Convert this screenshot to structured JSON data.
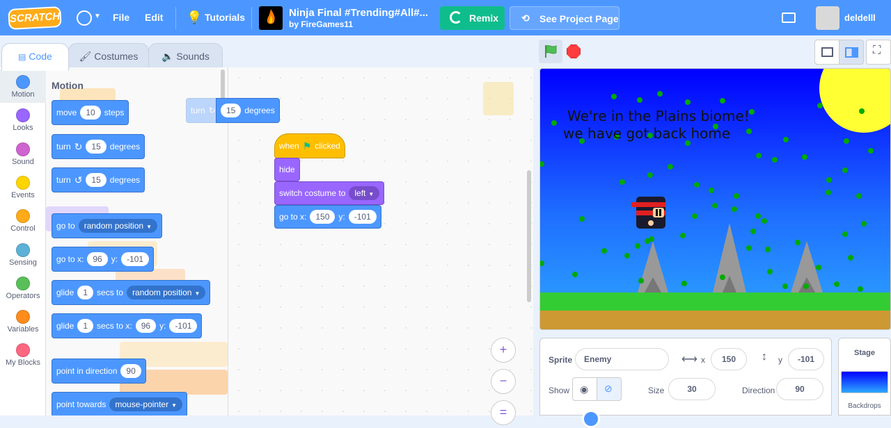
{
  "menubar": {
    "logo": "SCRATCH",
    "file": "File",
    "edit": "Edit",
    "tutorials": "Tutorials",
    "project_title": "Ninja Final #Trending#All#...",
    "project_author": "by FireGames11",
    "remix": "Remix",
    "see_project": "See Project Page",
    "username": "deldelll"
  },
  "tabs": {
    "code": "Code",
    "costumes": "Costumes",
    "sounds": "Sounds"
  },
  "categories": [
    {
      "label": "Motion",
      "color": "#4c97ff"
    },
    {
      "label": "Looks",
      "color": "#9966ff"
    },
    {
      "label": "Sound",
      "color": "#cf63cf"
    },
    {
      "label": "Events",
      "color": "#ffd500"
    },
    {
      "label": "Control",
      "color": "#ffab19"
    },
    {
      "label": "Sensing",
      "color": "#5cb1d6"
    },
    {
      "label": "Operators",
      "color": "#59c059"
    },
    {
      "label": "Variables",
      "color": "#ff8c1a"
    },
    {
      "label": "My Blocks",
      "color": "#ff6680"
    }
  ],
  "flyout": {
    "title": "Motion",
    "move": {
      "label": "move",
      "value": "10",
      "suffix": "steps"
    },
    "turn_right": {
      "label": "turn",
      "value": "15",
      "suffix": "degrees"
    },
    "turn_left": {
      "label": "turn",
      "value": "15",
      "suffix": "degrees"
    },
    "goto": {
      "label": "go to",
      "option": "random position"
    },
    "goto_xy": {
      "label": "go to x:",
      "x": "96",
      "ylabel": "y:",
      "y": "-101"
    },
    "glide": {
      "label": "glide",
      "value": "1",
      "mid": "secs to",
      "option": "random position"
    },
    "glide_xy": {
      "label": "glide",
      "value": "1",
      "mid": "secs to x:",
      "x": "96",
      "ylabel": "y:",
      "y": "-101"
    },
    "point_dir": {
      "label": "point in direction",
      "value": "90"
    },
    "point_towards": {
      "label": "point towards",
      "option": "mouse-pointer"
    }
  },
  "workspace": {
    "dragging_turn": {
      "label": "turn",
      "value": "15",
      "suffix": "degrees"
    },
    "when_clicked": {
      "pre": "when",
      "post": "clicked"
    },
    "hide": "hide",
    "switch_costume": {
      "label": "switch costume to",
      "option": "left"
    },
    "goto_xy": {
      "label": "go to x:",
      "x": "150",
      "ylabel": "y:",
      "y": "-101"
    }
  },
  "stage": {
    "line1": "We're in the Plains biome!",
    "line2": "we have got back home"
  },
  "sprite_info": {
    "sprite_label": "Sprite",
    "sprite_name": "Enemy",
    "x_label": "x",
    "x": "150",
    "y_label": "y",
    "y": "-101",
    "show_label": "Show",
    "size_label": "Size",
    "size": "30",
    "direction_label": "Direction",
    "direction": "90"
  },
  "stage_pane": {
    "title": "Stage",
    "backdrops": "Backdrops"
  }
}
